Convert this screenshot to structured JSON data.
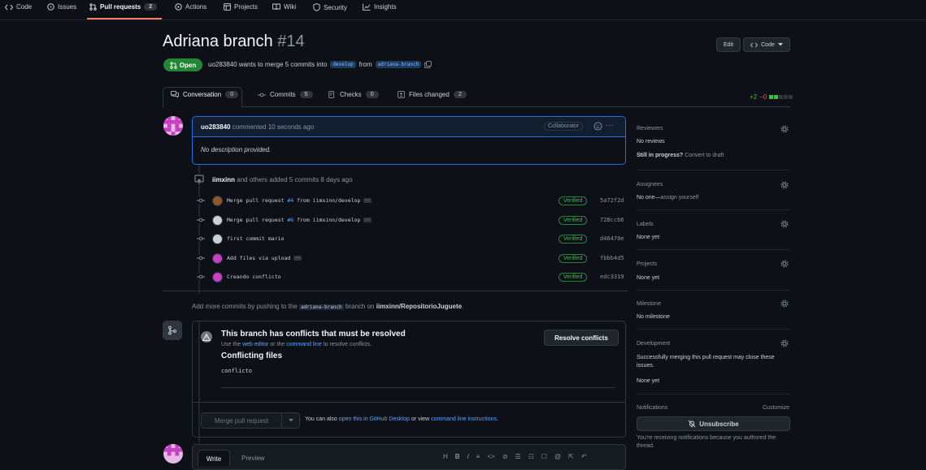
{
  "nav": {
    "tabs": [
      {
        "label": "Code"
      },
      {
        "label": "Issues"
      },
      {
        "label": "Pull requests",
        "count": "2"
      },
      {
        "label": "Actions"
      },
      {
        "label": "Projects"
      },
      {
        "label": "Wiki"
      },
      {
        "label": "Security"
      },
      {
        "label": "Insights"
      }
    ]
  },
  "pr": {
    "title": "Adriana branch",
    "number": "#14",
    "state": "Open",
    "meta_prefix": "uo283840 wants to merge 5 commits into",
    "base_branch": "develop",
    "meta_from": "from",
    "head_branch": "adriana-branch"
  },
  "header_buttons": {
    "edit": "Edit",
    "code": "Code"
  },
  "tabs": [
    {
      "label": "Conversation",
      "count": "0"
    },
    {
      "label": "Commits",
      "count": "5"
    },
    {
      "label": "Checks",
      "count": "0"
    },
    {
      "label": "Files changed",
      "count": "2"
    }
  ],
  "diffstat": {
    "added": "+2",
    "removed": "−0"
  },
  "comment": {
    "author": "uo283840",
    "action": "commented 10 seconds ago",
    "badge": "Collaborator",
    "body": "No description provided."
  },
  "commits_header": {
    "author": "iimxinn",
    "text": "and others added 5 commits 8 days ago"
  },
  "commits": [
    {
      "message": "Merge pull request ",
      "ref": "#4",
      "tail": " from iimxinn/develop",
      "has_more": true,
      "verified": "Verified",
      "sha": "5a72f2d"
    },
    {
      "message": "Merge pull request ",
      "ref": "#6",
      "tail": " from iimxinn/develop",
      "has_more": true,
      "verified": "Verified",
      "sha": "728ccb6"
    },
    {
      "message": "first commit mario",
      "ref": "",
      "tail": "",
      "has_more": false,
      "verified": "Verified",
      "sha": "d46470e"
    },
    {
      "message": "Add files via upload",
      "ref": "",
      "tail": "",
      "has_more": true,
      "verified": "Verified",
      "sha": "fbbb4d5"
    },
    {
      "message": "Creando conflicto",
      "ref": "",
      "tail": "",
      "has_more": false,
      "verified": "Verified",
      "sha": "edc3319"
    }
  ],
  "more_commits": {
    "prefix": "Add more commits by pushing to the",
    "branch": "adriana-branch",
    "middle": "branch on",
    "repo": "iimxinn/RepositorioJuguete",
    "suffix": "."
  },
  "conflict": {
    "title": "This branch has conflicts that must be resolved",
    "use": "Use the",
    "web_editor": "web editor",
    "or_the": "or the",
    "command_line": "command line",
    "tail": "to resolve conflicts.",
    "files_title": "Conflicting files",
    "file": "conflicto",
    "resolve_button": "Resolve conflicts"
  },
  "merge": {
    "button": "Merge pull request",
    "note_prefix": "You can also",
    "desktop_link": "open this in GitHub Desktop",
    "note_mid": "or view",
    "cli_link": "command line instructions",
    "note_suffix": "."
  },
  "composer": {
    "write": "Write",
    "preview": "Preview"
  },
  "sidebar": {
    "reviewers": {
      "title": "Reviewers",
      "value": "No reviews",
      "progress_bold": "Still in progress?",
      "progress_link": "Convert to draft"
    },
    "assignees": {
      "title": "Assignees",
      "value": "No one—",
      "link": "assign yourself"
    },
    "labels": {
      "title": "Labels",
      "value": "None yet"
    },
    "projects": {
      "title": "Projects",
      "value": "None yet"
    },
    "milestone": {
      "title": "Milestone",
      "value": "No milestone"
    },
    "development": {
      "title": "Development",
      "text": "Successfully merging this pull request may close these issues.",
      "value": "None yet"
    },
    "notifications": {
      "title": "Notifications",
      "customize": "Customize",
      "button": "Unsubscribe",
      "note": "You're receiving notifications because you authored the thread."
    }
  },
  "colors": {
    "green": "#238636",
    "blue": "#1f6feb",
    "bg": "#0d1117"
  }
}
